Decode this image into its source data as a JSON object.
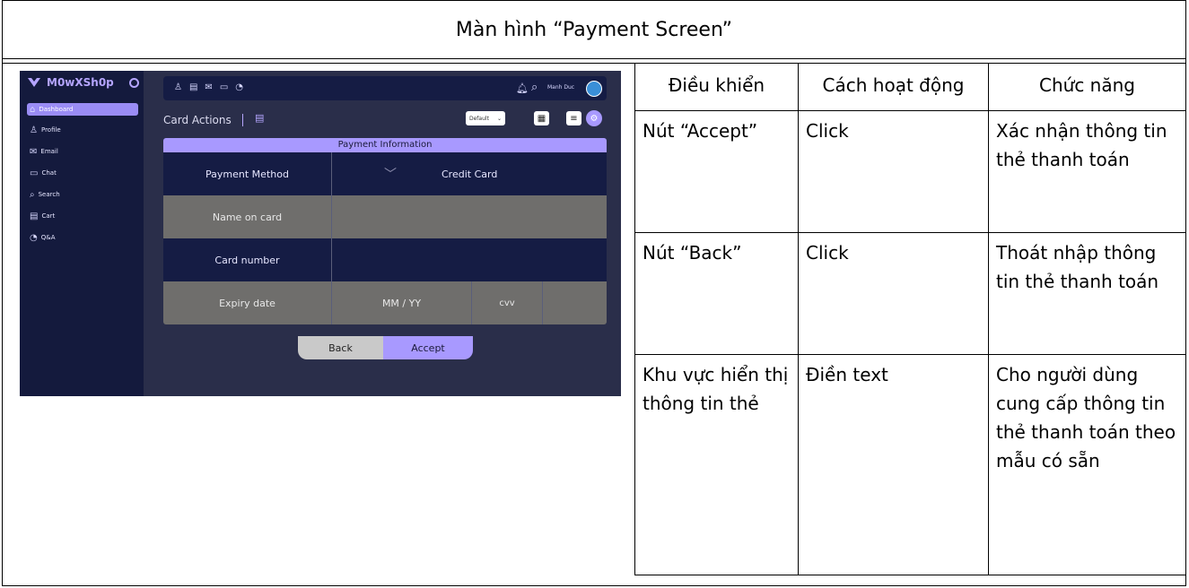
{
  "page_title": "Màn hình “Payment Screen”",
  "spec_table": {
    "headers": [
      "Điều khiển",
      "Cách hoạt động",
      "Chức năng"
    ],
    "rows": [
      [
        "Nút “Accept”",
        "Click",
        "Xác nhận thông tin thẻ thanh toán"
      ],
      [
        "Nút “Back”",
        "Click",
        "Thoát nhập thông tin thẻ thanh toán"
      ],
      [
        "Khu vực hiển thị thông tin thẻ",
        "Điền text",
        "Cho người dùng cung cấp thông tin thẻ thanh toán theo mẫu có sẵn"
      ]
    ]
  },
  "app": {
    "brand": "M0wXSh0p",
    "nav": [
      "Dashboard",
      "Profile",
      "Email",
      "Chat",
      "Search",
      "Cart",
      "Q&A"
    ],
    "user_name": "Manh Duc",
    "card_title": "Card Actions",
    "view_select": "Default",
    "payment": {
      "header": "Payment Information",
      "method_label": "Payment Method",
      "method_value": "Credit Card",
      "name_label": "Name on card",
      "number_label": "Card number",
      "expiry_label": "Expiry date",
      "expiry_placeholder": "MM / YY",
      "cvv_placeholder": "cvv"
    },
    "back_label": "Back",
    "accept_label": "Accept",
    "colors": {
      "sidebar": "#141a3d",
      "accent": "#a899ff",
      "grey_row": "#6f6e6c"
    }
  }
}
